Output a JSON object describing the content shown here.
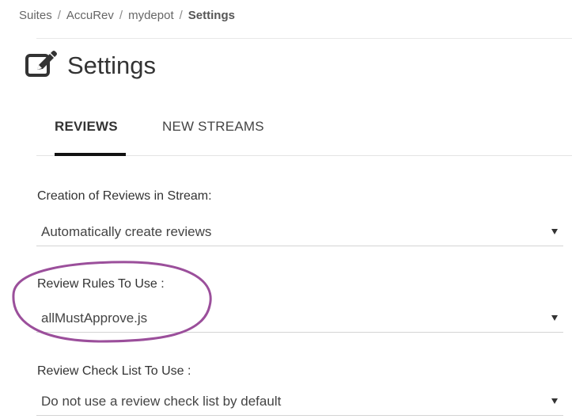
{
  "breadcrumb": {
    "items": [
      "Suites",
      "AccuRev",
      "mydepot"
    ],
    "current": "Settings",
    "separator": "/"
  },
  "page": {
    "title": "Settings",
    "title_icon": "edit-icon"
  },
  "tabs": [
    {
      "label": "REVIEWS",
      "active": true
    },
    {
      "label": "NEW STREAMS",
      "active": false
    }
  ],
  "reviews": {
    "creation": {
      "label": "Creation of Reviews in Stream:",
      "value": "Automatically create reviews"
    },
    "rules": {
      "label": "Review Rules To Use :",
      "value": "allMustApprove.js"
    },
    "checklist": {
      "label": "Review Check List To Use :",
      "value": "Do not use a review check list by default"
    }
  },
  "colors": {
    "annotation": "#9b4f9b",
    "active_tab_underline": "#111111",
    "divider": "#d4d4d4"
  }
}
